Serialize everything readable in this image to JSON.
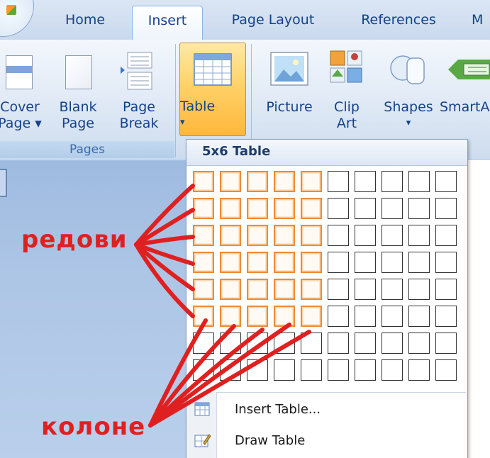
{
  "ribbon": {
    "tabs": [
      {
        "label": "Home"
      },
      {
        "label": "Insert"
      },
      {
        "label": "Page Layout"
      },
      {
        "label": "References"
      },
      {
        "label": "M"
      }
    ],
    "buttons": {
      "cover_page": "Cover\nPage ▾",
      "blank_page": "Blank\nPage",
      "page_break": "Page\nBreak",
      "table": "Table",
      "table_arrow": "▾",
      "picture": "Picture",
      "clip_art": "Clip\nArt",
      "shapes": "Shapes",
      "shapes_arrow": "▾",
      "smartart": "SmartA"
    },
    "groups": {
      "pages": "Pages"
    }
  },
  "table_dropdown": {
    "title": "5x6 Table",
    "grid_columns": 10,
    "grid_rows": 8,
    "selected_columns": 5,
    "selected_rows": 6,
    "highlight_color": "#ee8b35",
    "menu": [
      {
        "label": "Insert Table...",
        "icon": "insert-table-icon"
      },
      {
        "label": "Draw Table",
        "icon": "draw-table-icon"
      }
    ]
  },
  "annotations": {
    "rows_label": "редови",
    "columns_label": "колоне",
    "color": "#e02020"
  }
}
